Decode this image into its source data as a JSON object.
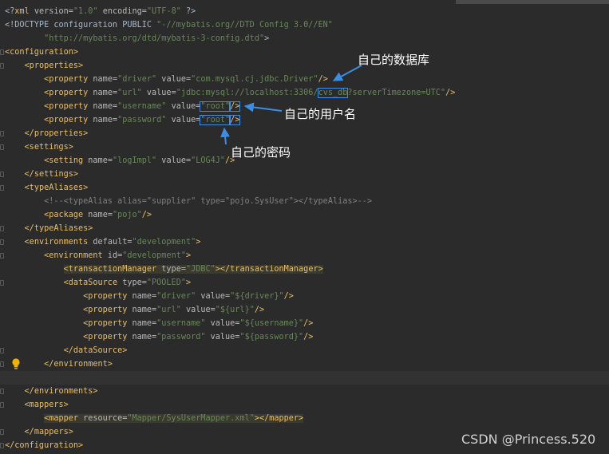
{
  "editor": {
    "lines": [
      {
        "seg": [
          [
            "p",
            "<?"
          ],
          [
            "t",
            "xml"
          ],
          [
            "a",
            " version="
          ],
          [
            "v",
            "\"1.0\""
          ],
          [
            "a",
            " encoding="
          ],
          [
            "v",
            "\"UTF-8\""
          ],
          [
            "p",
            " ?>"
          ]
        ]
      },
      {
        "seg": [
          [
            "p",
            "<!DOCTYPE configuration PUBLIC "
          ],
          [
            "v",
            "\"-//mybatis.org//DTD Config 3.0//EN\""
          ]
        ]
      },
      {
        "seg": [
          [
            "p",
            "        "
          ],
          [
            "v",
            "\"http://mybatis.org/dtd/mybatis-3-config.dtd\""
          ],
          [
            "p",
            ">"
          ]
        ]
      },
      {
        "seg": [
          [
            "t",
            "<configuration>"
          ]
        ]
      },
      {
        "seg": [
          [
            "p",
            "    "
          ],
          [
            "t",
            "<properties>"
          ]
        ]
      },
      {
        "seg": [
          [
            "p",
            "        "
          ],
          [
            "t",
            "<property"
          ],
          [
            "a",
            " name="
          ],
          [
            "v",
            "\"driver\""
          ],
          [
            "a",
            " value="
          ],
          [
            "v",
            "\"com.mysql.cj.jdbc.Driver\""
          ],
          [
            "t",
            "/>"
          ]
        ]
      },
      {
        "seg": [
          [
            "p",
            "        "
          ],
          [
            "t",
            "<property"
          ],
          [
            "a",
            " name="
          ],
          [
            "v",
            "\"url\""
          ],
          [
            "a",
            " value="
          ],
          [
            "v",
            "\"jdbc:mysql://localhost:3306/"
          ],
          [
            "vbox",
            "cvs_db"
          ],
          [
            "v",
            "?serverTimezone=UTC\""
          ],
          [
            "t",
            "/>"
          ]
        ]
      },
      {
        "seg": [
          [
            "p",
            "        "
          ],
          [
            "t",
            "<property"
          ],
          [
            "a",
            " name="
          ],
          [
            "v",
            "\"username\""
          ],
          [
            "a",
            " value="
          ],
          [
            "vbox",
            "\"root\""
          ],
          [
            "tbox",
            "/>"
          ]
        ]
      },
      {
        "seg": [
          [
            "p",
            "        "
          ],
          [
            "t",
            "<property"
          ],
          [
            "a",
            " name="
          ],
          [
            "v",
            "\"password\""
          ],
          [
            "a",
            " value="
          ],
          [
            "vbox",
            "\"root\""
          ],
          [
            "tbox",
            "/>"
          ]
        ]
      },
      {
        "seg": [
          [
            "p",
            "    "
          ],
          [
            "t",
            "</properties>"
          ]
        ]
      },
      {
        "seg": [
          [
            "p",
            "    "
          ],
          [
            "t",
            "<settings>"
          ]
        ]
      },
      {
        "seg": [
          [
            "p",
            "        "
          ],
          [
            "t",
            "<setting"
          ],
          [
            "a",
            " name="
          ],
          [
            "v",
            "\"logImpl\""
          ],
          [
            "a",
            " value="
          ],
          [
            "v",
            "\"LOG4J\""
          ],
          [
            "t",
            "/>"
          ]
        ]
      },
      {
        "seg": [
          [
            "p",
            "    "
          ],
          [
            "t",
            "</settings>"
          ]
        ]
      },
      {
        "seg": [
          [
            "p",
            "    "
          ],
          [
            "t",
            "<typeAliases>"
          ]
        ]
      },
      {
        "seg": [
          [
            "p",
            "        "
          ],
          [
            "c",
            "<!--<typeAlias alias=\"supplier\" type=\"pojo.SysUser\"></typeAlias>-->"
          ]
        ]
      },
      {
        "seg": [
          [
            "p",
            "        "
          ],
          [
            "t",
            "<package"
          ],
          [
            "a",
            " name="
          ],
          [
            "v",
            "\"pojo\""
          ],
          [
            "t",
            "/>"
          ]
        ]
      },
      {
        "seg": [
          [
            "p",
            "    "
          ],
          [
            "t",
            "</typeAliases>"
          ]
        ]
      },
      {
        "seg": [
          [
            "p",
            "    "
          ],
          [
            "t",
            "<environments"
          ],
          [
            "a",
            " default="
          ],
          [
            "v",
            "\"development\""
          ],
          [
            "t",
            ">"
          ]
        ]
      },
      {
        "seg": [
          [
            "p",
            "        "
          ],
          [
            "t",
            "<environment"
          ],
          [
            "a",
            " id="
          ],
          [
            "v",
            "\"development\""
          ],
          [
            "t",
            ">"
          ]
        ]
      },
      {
        "seg": [
          [
            "p",
            "            "
          ],
          [
            "thl",
            "<transactionManager"
          ],
          [
            "ahl",
            " type="
          ],
          [
            "vhl",
            "\"JDBC\""
          ],
          [
            "thl",
            "></transactionManager>"
          ]
        ]
      },
      {
        "seg": [
          [
            "p",
            "            "
          ],
          [
            "t",
            "<dataSource"
          ],
          [
            "a",
            " type="
          ],
          [
            "v",
            "\"POOLED\""
          ],
          [
            "t",
            ">"
          ]
        ]
      },
      {
        "seg": [
          [
            "p",
            "                "
          ],
          [
            "t",
            "<property"
          ],
          [
            "a",
            " name="
          ],
          [
            "v",
            "\"driver\""
          ],
          [
            "a",
            " value="
          ],
          [
            "v",
            "\"${driver}\""
          ],
          [
            "t",
            "/>"
          ]
        ]
      },
      {
        "seg": [
          [
            "p",
            "                "
          ],
          [
            "t",
            "<property"
          ],
          [
            "a",
            " name="
          ],
          [
            "v",
            "\"url\""
          ],
          [
            "a",
            " value="
          ],
          [
            "v",
            "\"${url}\""
          ],
          [
            "t",
            "/>"
          ]
        ]
      },
      {
        "seg": [
          [
            "p",
            "                "
          ],
          [
            "t",
            "<property"
          ],
          [
            "a",
            " name="
          ],
          [
            "v",
            "\"username\""
          ],
          [
            "a",
            " value="
          ],
          [
            "v",
            "\"${username}\""
          ],
          [
            "t",
            "/>"
          ]
        ]
      },
      {
        "seg": [
          [
            "p",
            "                "
          ],
          [
            "t",
            "<property"
          ],
          [
            "a",
            " name="
          ],
          [
            "v",
            "\"password\""
          ],
          [
            "a",
            " value="
          ],
          [
            "v",
            "\"${password}\""
          ],
          [
            "t",
            "/>"
          ]
        ]
      },
      {
        "seg": [
          [
            "p",
            "            "
          ],
          [
            "t",
            "</dataSource>"
          ]
        ]
      },
      {
        "seg": [
          [
            "p",
            "        "
          ],
          [
            "t",
            "</environment>"
          ]
        ]
      },
      {
        "seg": [
          [
            "p",
            ""
          ]
        ]
      },
      {
        "seg": [
          [
            "p",
            "    "
          ],
          [
            "t",
            "</environments>"
          ]
        ]
      },
      {
        "seg": [
          [
            "p",
            "    "
          ],
          [
            "t",
            "<mappers>"
          ]
        ]
      },
      {
        "seg": [
          [
            "p",
            "        "
          ],
          [
            "thl",
            "<mapper"
          ],
          [
            "ahl",
            " resource="
          ],
          [
            "vhl",
            "\"Mapper/SysUserMapper.xml\""
          ],
          [
            "thl",
            "></mapper>"
          ]
        ]
      },
      {
        "seg": [
          [
            "p",
            "    "
          ],
          [
            "t",
            "</mappers>"
          ]
        ]
      },
      {
        "seg": [
          [
            "t",
            "</configuration>"
          ]
        ]
      }
    ]
  },
  "annotations": {
    "database": "自己的数据库",
    "username": "自己的用户名",
    "password": "自己的密码"
  },
  "watermark": "CSDN @Princess.520",
  "colors": {
    "background": "#2b2b2b",
    "tag": "#e8bf6a",
    "attribute": "#bababa",
    "value": "#6a8759",
    "comment": "#808080",
    "arrow": "#3a8ee6"
  },
  "icons": {
    "intention": "lightbulb-icon"
  }
}
